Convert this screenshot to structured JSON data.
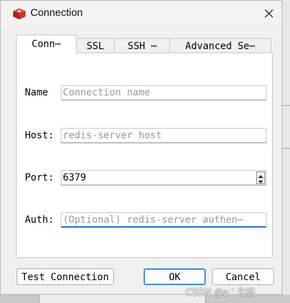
{
  "window": {
    "title": "Connection"
  },
  "tabs": [
    {
      "label": "Conn⋯"
    },
    {
      "label": "SSL"
    },
    {
      "label": "SSH ⋯"
    },
    {
      "label": "Advanced Se⋯"
    }
  ],
  "form": {
    "name": {
      "label": "Name",
      "value": "",
      "placeholder": "Connection name"
    },
    "host": {
      "label": "Host:",
      "value": "",
      "placeholder": "redis-server host"
    },
    "port": {
      "label": "Port:",
      "value": "6379"
    },
    "auth": {
      "label": "Auth:",
      "value": "",
      "placeholder": "(Optional) redis-server authen⋯"
    }
  },
  "buttons": {
    "test": "Test Connection",
    "ok": "OK",
    "cancel": "Cancel"
  },
  "watermark": "CSDN @a '   北觞",
  "icons": {
    "app": "redis-logo-icon",
    "close": "close-icon",
    "spin_up": "spin-up-icon",
    "spin_down": "spin-down-icon"
  },
  "colors": {
    "focus": "#1c6fc4",
    "default_button_border": "#2b7cd3",
    "app_icon": "#c6302b"
  }
}
